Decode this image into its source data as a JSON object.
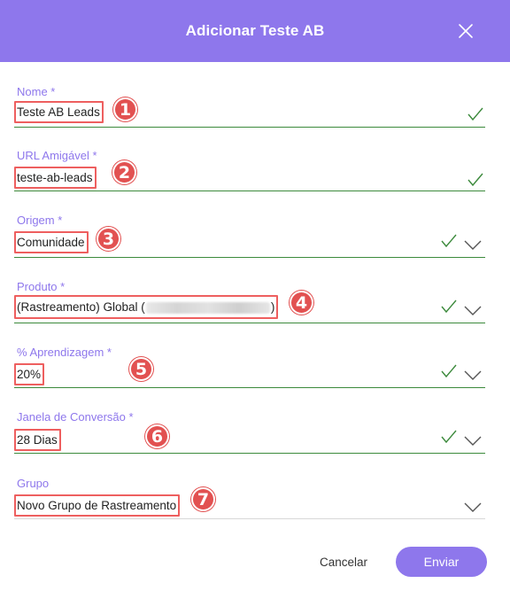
{
  "dialog": {
    "title": "Adicionar Teste AB"
  },
  "fields": [
    {
      "label": "Nome *",
      "value": "Teste AB Leads",
      "badge": "1"
    },
    {
      "label": "URL Amigável *",
      "value": "teste-ab-leads",
      "badge": "2"
    },
    {
      "label": "Origem *",
      "value": "Comunidade",
      "badge": "3"
    },
    {
      "label": "Produto *",
      "value_prefix": "(Rastreamento) Global (",
      "value_suffix": ")",
      "badge": "4"
    },
    {
      "label": "% Aprendizagem *",
      "value": "20%",
      "badge": "5"
    },
    {
      "label": "Janela de Conversão *",
      "value": "28 Dias",
      "badge": "6"
    },
    {
      "label": "Grupo",
      "value": "Novo Grupo de Rastreamento",
      "badge": "7"
    }
  ],
  "actions": {
    "cancel_label": "Cancelar",
    "submit_label": "Enviar"
  },
  "colors": {
    "accent": "#8e77ec",
    "valid": "#3c8a3c",
    "annotation": "#e25151"
  },
  "icons": {
    "close": "close-icon",
    "valid": "check-icon",
    "dropdown": "chevron-down-icon"
  }
}
